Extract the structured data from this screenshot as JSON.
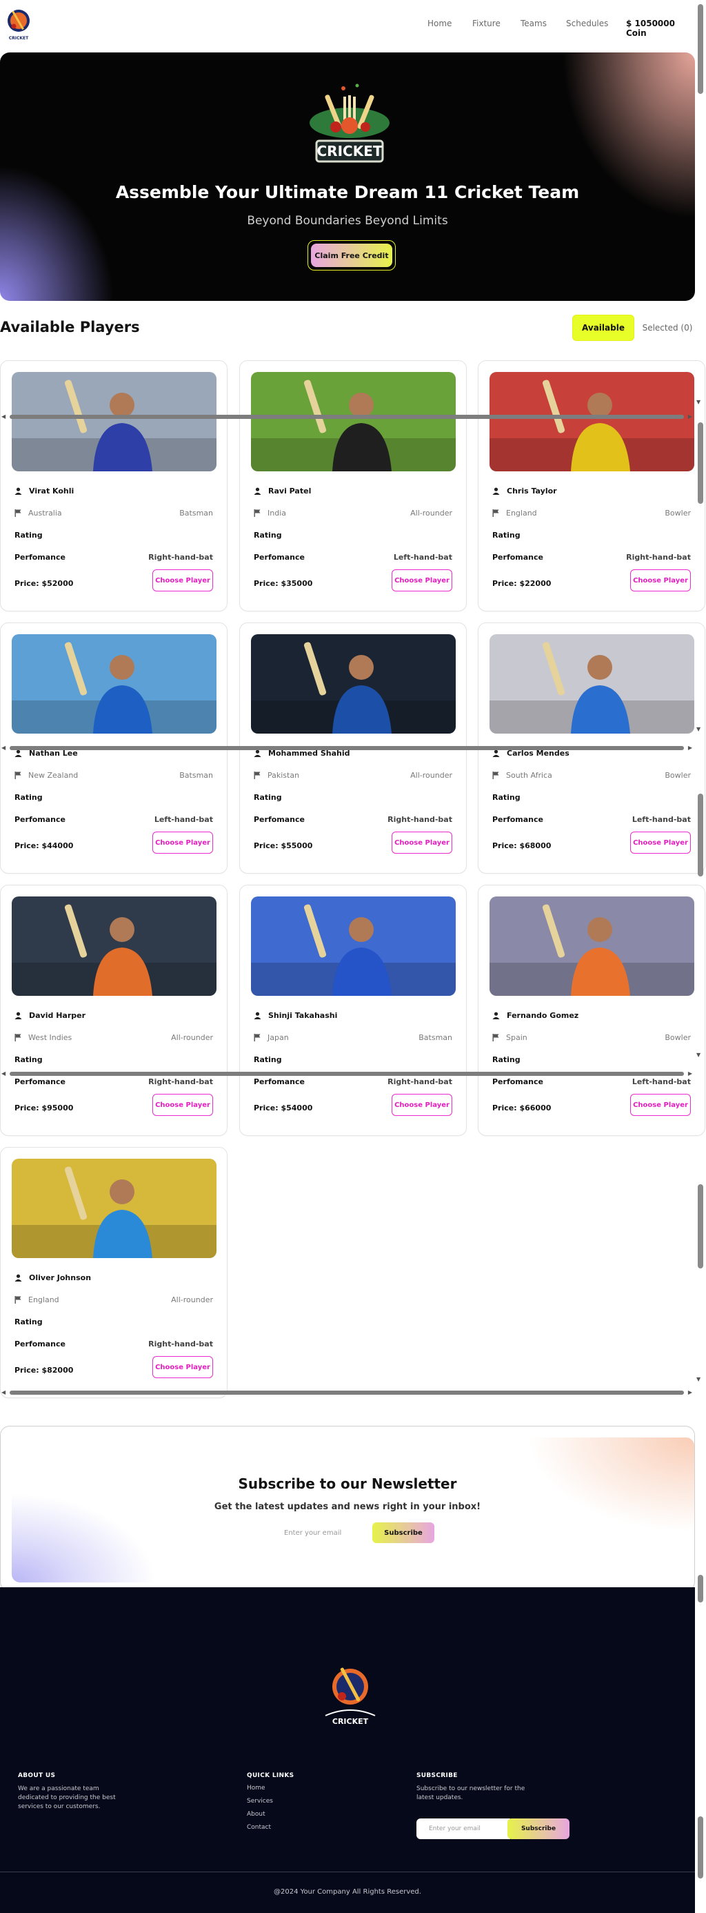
{
  "nav": {
    "links": [
      "Home",
      "Fixture",
      "Teams",
      "Schedules"
    ],
    "coins": "$ 1050000 Coin"
  },
  "hero": {
    "badge": "CRICKET",
    "title": "Assemble Your Ultimate Dream 11 Cricket Team",
    "subtitle": "Beyond Boundaries Beyond Limits",
    "cta": "Claim Free Credit"
  },
  "players_section": {
    "title": "Available Players",
    "available_label": "Available",
    "selected_label": "Selected (0)"
  },
  "player_card_labels": {
    "rating": "Rating",
    "performance": "Perfomance",
    "choose": "Choose Player"
  },
  "players": [
    {
      "name": "Virat Kohli",
      "country": "Australia",
      "role": "Batsman",
      "batting": "Right-hand-bat",
      "price": "Price: $52000",
      "kit": "#2f3fa8",
      "bg": "#9aa7b8"
    },
    {
      "name": "Ravi Patel",
      "country": "India",
      "role": "All-rounder",
      "batting": "Left-hand-bat",
      "price": "Price: $35000",
      "kit": "#1f1f1f",
      "bg": "#6aa23a"
    },
    {
      "name": "Chris Taylor",
      "country": "England",
      "role": "Bowler",
      "batting": "Right-hand-bat",
      "price": "Price: $22000",
      "kit": "#e2c21a",
      "bg": "#c8403a"
    },
    {
      "name": "Nathan Lee",
      "country": "New Zealand",
      "role": "Batsman",
      "batting": "Left-hand-bat",
      "price": "Price: $44000",
      "kit": "#1e5fc4",
      "bg": "#5da0d6"
    },
    {
      "name": "Mohammed Shahid",
      "country": "Pakistan",
      "role": "All-rounder",
      "batting": "Right-hand-bat",
      "price": "Price: $55000",
      "kit": "#1b4fa8",
      "bg": "#1a2432"
    },
    {
      "name": "Carlos Mendes",
      "country": "South Africa",
      "role": "Bowler",
      "batting": "Left-hand-bat",
      "price": "Price: $68000",
      "kit": "#2a6fd0",
      "bg": "#c8c8d0"
    },
    {
      "name": "David Harper",
      "country": "West Indies",
      "role": "All-rounder",
      "batting": "Right-hand-bat",
      "price": "Price: $95000",
      "kit": "#e06d2a",
      "bg": "#2f3a4a"
    },
    {
      "name": "Shinji Takahashi",
      "country": "Japan",
      "role": "Batsman",
      "batting": "Right-hand-bat",
      "price": "Price: $54000",
      "kit": "#2454c8",
      "bg": "#3f6ad0"
    },
    {
      "name": "Fernando Gomez",
      "country": "Spain",
      "role": "Bowler",
      "batting": "Left-hand-bat",
      "price": "Price: $66000",
      "kit": "#e8712e",
      "bg": "#8a8aa8"
    },
    {
      "name": "Oliver Johnson",
      "country": "England",
      "role": "All-rounder",
      "batting": "Right-hand-bat",
      "price": "Price: $82000",
      "kit": "#2a8ad8",
      "bg": "#d6b83a"
    }
  ],
  "newsletter": {
    "title": "Subscribe to our Newsletter",
    "subtitle": "Get the latest updates and news right in your inbox!",
    "placeholder": "Enter your email",
    "button": "Subscribe"
  },
  "footer": {
    "logo_text": "CRICKET",
    "about_title": "ABOUT US",
    "about_text": "We are a passionate team dedicated to providing the best services to our customers.",
    "links_title": "QUICK LINKS",
    "links": [
      "Home",
      "Services",
      "About",
      "Contact"
    ],
    "subscribe_title": "SUBSCRIBE",
    "subscribe_text": "Subscribe to our newsletter for the latest updates.",
    "placeholder": "Enter your email",
    "button": "Subscribe",
    "copyright": "@2024 Your Company All Rights Reserved."
  },
  "colors": {
    "accent_yellow": "#e7fe29",
    "accent_pink": "#e41fc0",
    "footer_bg": "#06091a"
  }
}
